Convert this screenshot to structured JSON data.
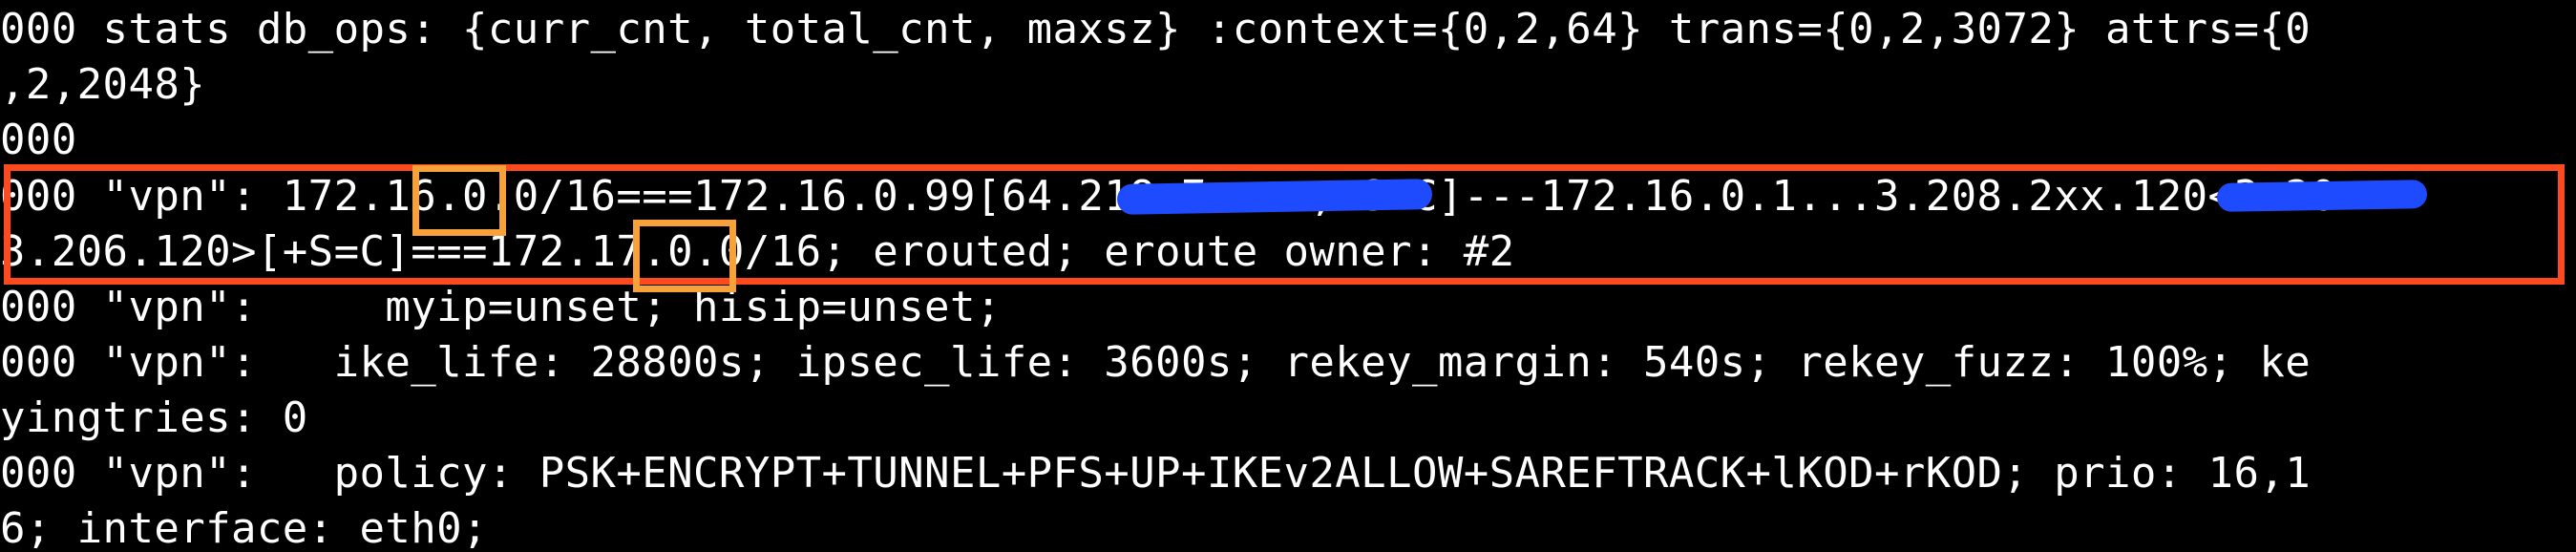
{
  "terminal": {
    "lines": [
      "000 stats db_ops: {curr_cnt, total_cnt, maxsz} :context={0,2,64} trans={0,2,3072} attrs={0",
      ",2,2048}",
      "000",
      "000 \"vpn\": 172.16.0.0/16===172.16.0.99[64.218.7.xxx,+S=C]---172.16.0.1...3.208.2xx.120<3.20",
      "3.206.120>[+S=C]===172.17.0.0/16; erouted; eroute owner: #2",
      "000 \"vpn\":     myip=unset; hisip=unset;",
      "000 \"vpn\":   ike_life: 28800s; ipsec_life: 3600s; rekey_margin: 540s; rekey_fuzz: 100%; ke",
      "yingtries: 0",
      "000 \"vpn\":   policy: PSK+ENCRYPT+TUNNEL+PFS+UP+IKEv2ALLOW+SAREFTRACK+lKOD+rKOD; prio: 16,1",
      "6; interface: eth0;"
    ]
  },
  "annotations": {
    "red_box_color": "#ff4a1f",
    "orange_box_color": "#f6a13a",
    "redaction_color": "#1f4bff",
    "highlight_1": "16",
    "highlight_2": "17"
  }
}
